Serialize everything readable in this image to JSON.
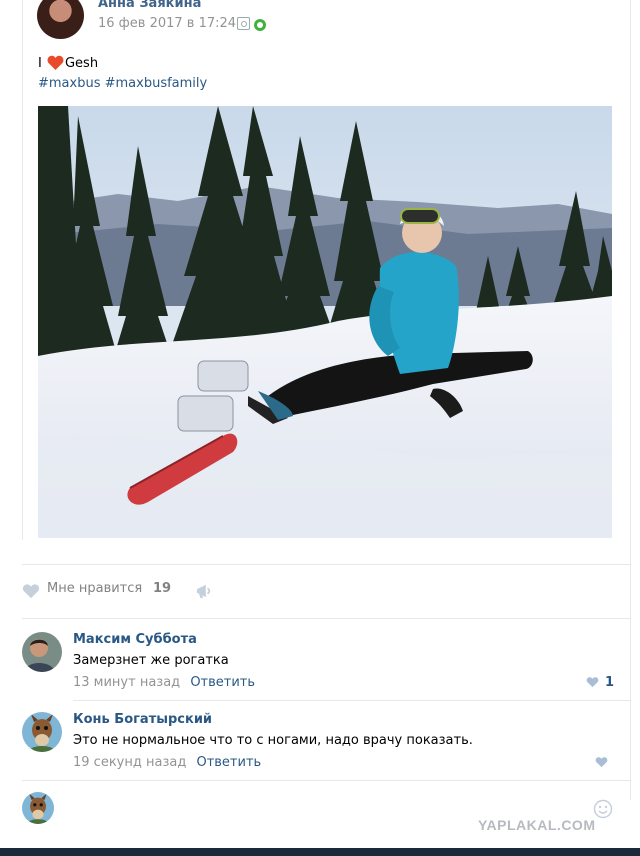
{
  "post": {
    "author": "Анна Заякина",
    "date": "16 фев 2017 в 17:24",
    "text_before": "I",
    "text_after": "Gesh",
    "hashtags": "#maxbus #maxbusfamily"
  },
  "likes": {
    "label": "Мне нравится",
    "count": "19"
  },
  "comments": [
    {
      "name": "Максим Суббота",
      "text": "Замерзнет же рогатка",
      "time": "13 минут назад",
      "reply": "Ответить",
      "likes": "1"
    },
    {
      "name": "Конь Богатырский",
      "text": "Это не нормальное что то с ногами, надо врачу показать.",
      "time": "19 секунд назад",
      "reply": "Ответить",
      "likes": ""
    }
  ],
  "watermark": "YAPLAKAL.COM",
  "colors": {
    "link": "#2a5885",
    "muted": "#939393",
    "heart": "#e64646",
    "online": "#3fb23e"
  }
}
